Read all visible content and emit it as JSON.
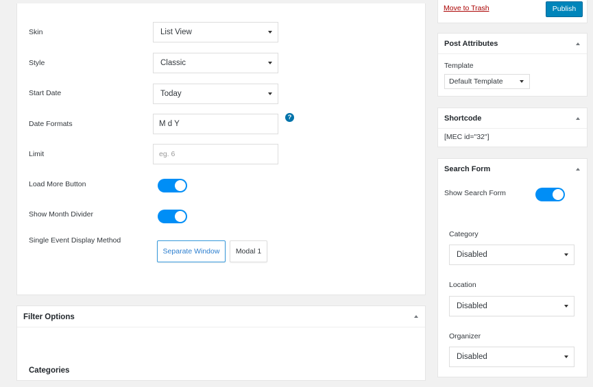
{
  "main": {
    "skin_label": "Skin",
    "skin_value": "List View",
    "style_label": "Style",
    "style_value": "Classic",
    "start_date_label": "Start Date",
    "start_date_value": "Today",
    "date_formats_label": "Date Formats",
    "date_formats_value": "M d Y",
    "help_glyph": "?",
    "limit_label": "Limit",
    "limit_placeholder": "eg. 6",
    "load_more_label": "Load More Button",
    "month_divider_label": "Show Month Divider",
    "display_method_label": "Single Event Display Method",
    "separate_window_label": "Separate Window",
    "modal_label": "Modal 1"
  },
  "filter": {
    "title": "Filter Options",
    "categories_label": "Categories"
  },
  "sidebar": {
    "trash_link": "Move to Trash",
    "publish_label": "Publish",
    "attributes_title": "Post Attributes",
    "template_label": "Template",
    "template_value": "Default Template",
    "shortcode_title": "Shortcode",
    "shortcode_value": "[MEC id=\"32\"]",
    "search_form_title": "Search Form",
    "show_search_form_label": "Show Search Form",
    "category_label": "Category",
    "category_value": "Disabled",
    "location_label": "Location",
    "location_value": "Disabled",
    "organizer_label": "Organizer",
    "organizer_value": "Disabled"
  },
  "colors": {
    "toggle_on": "#008ef6",
    "primary_button": "#0085ba",
    "trash_link": "#aa0000",
    "help_icon": "#0073aa"
  },
  "toggles": {
    "load_more_on": true,
    "month_divider_on": true,
    "show_search_form_on": true
  }
}
